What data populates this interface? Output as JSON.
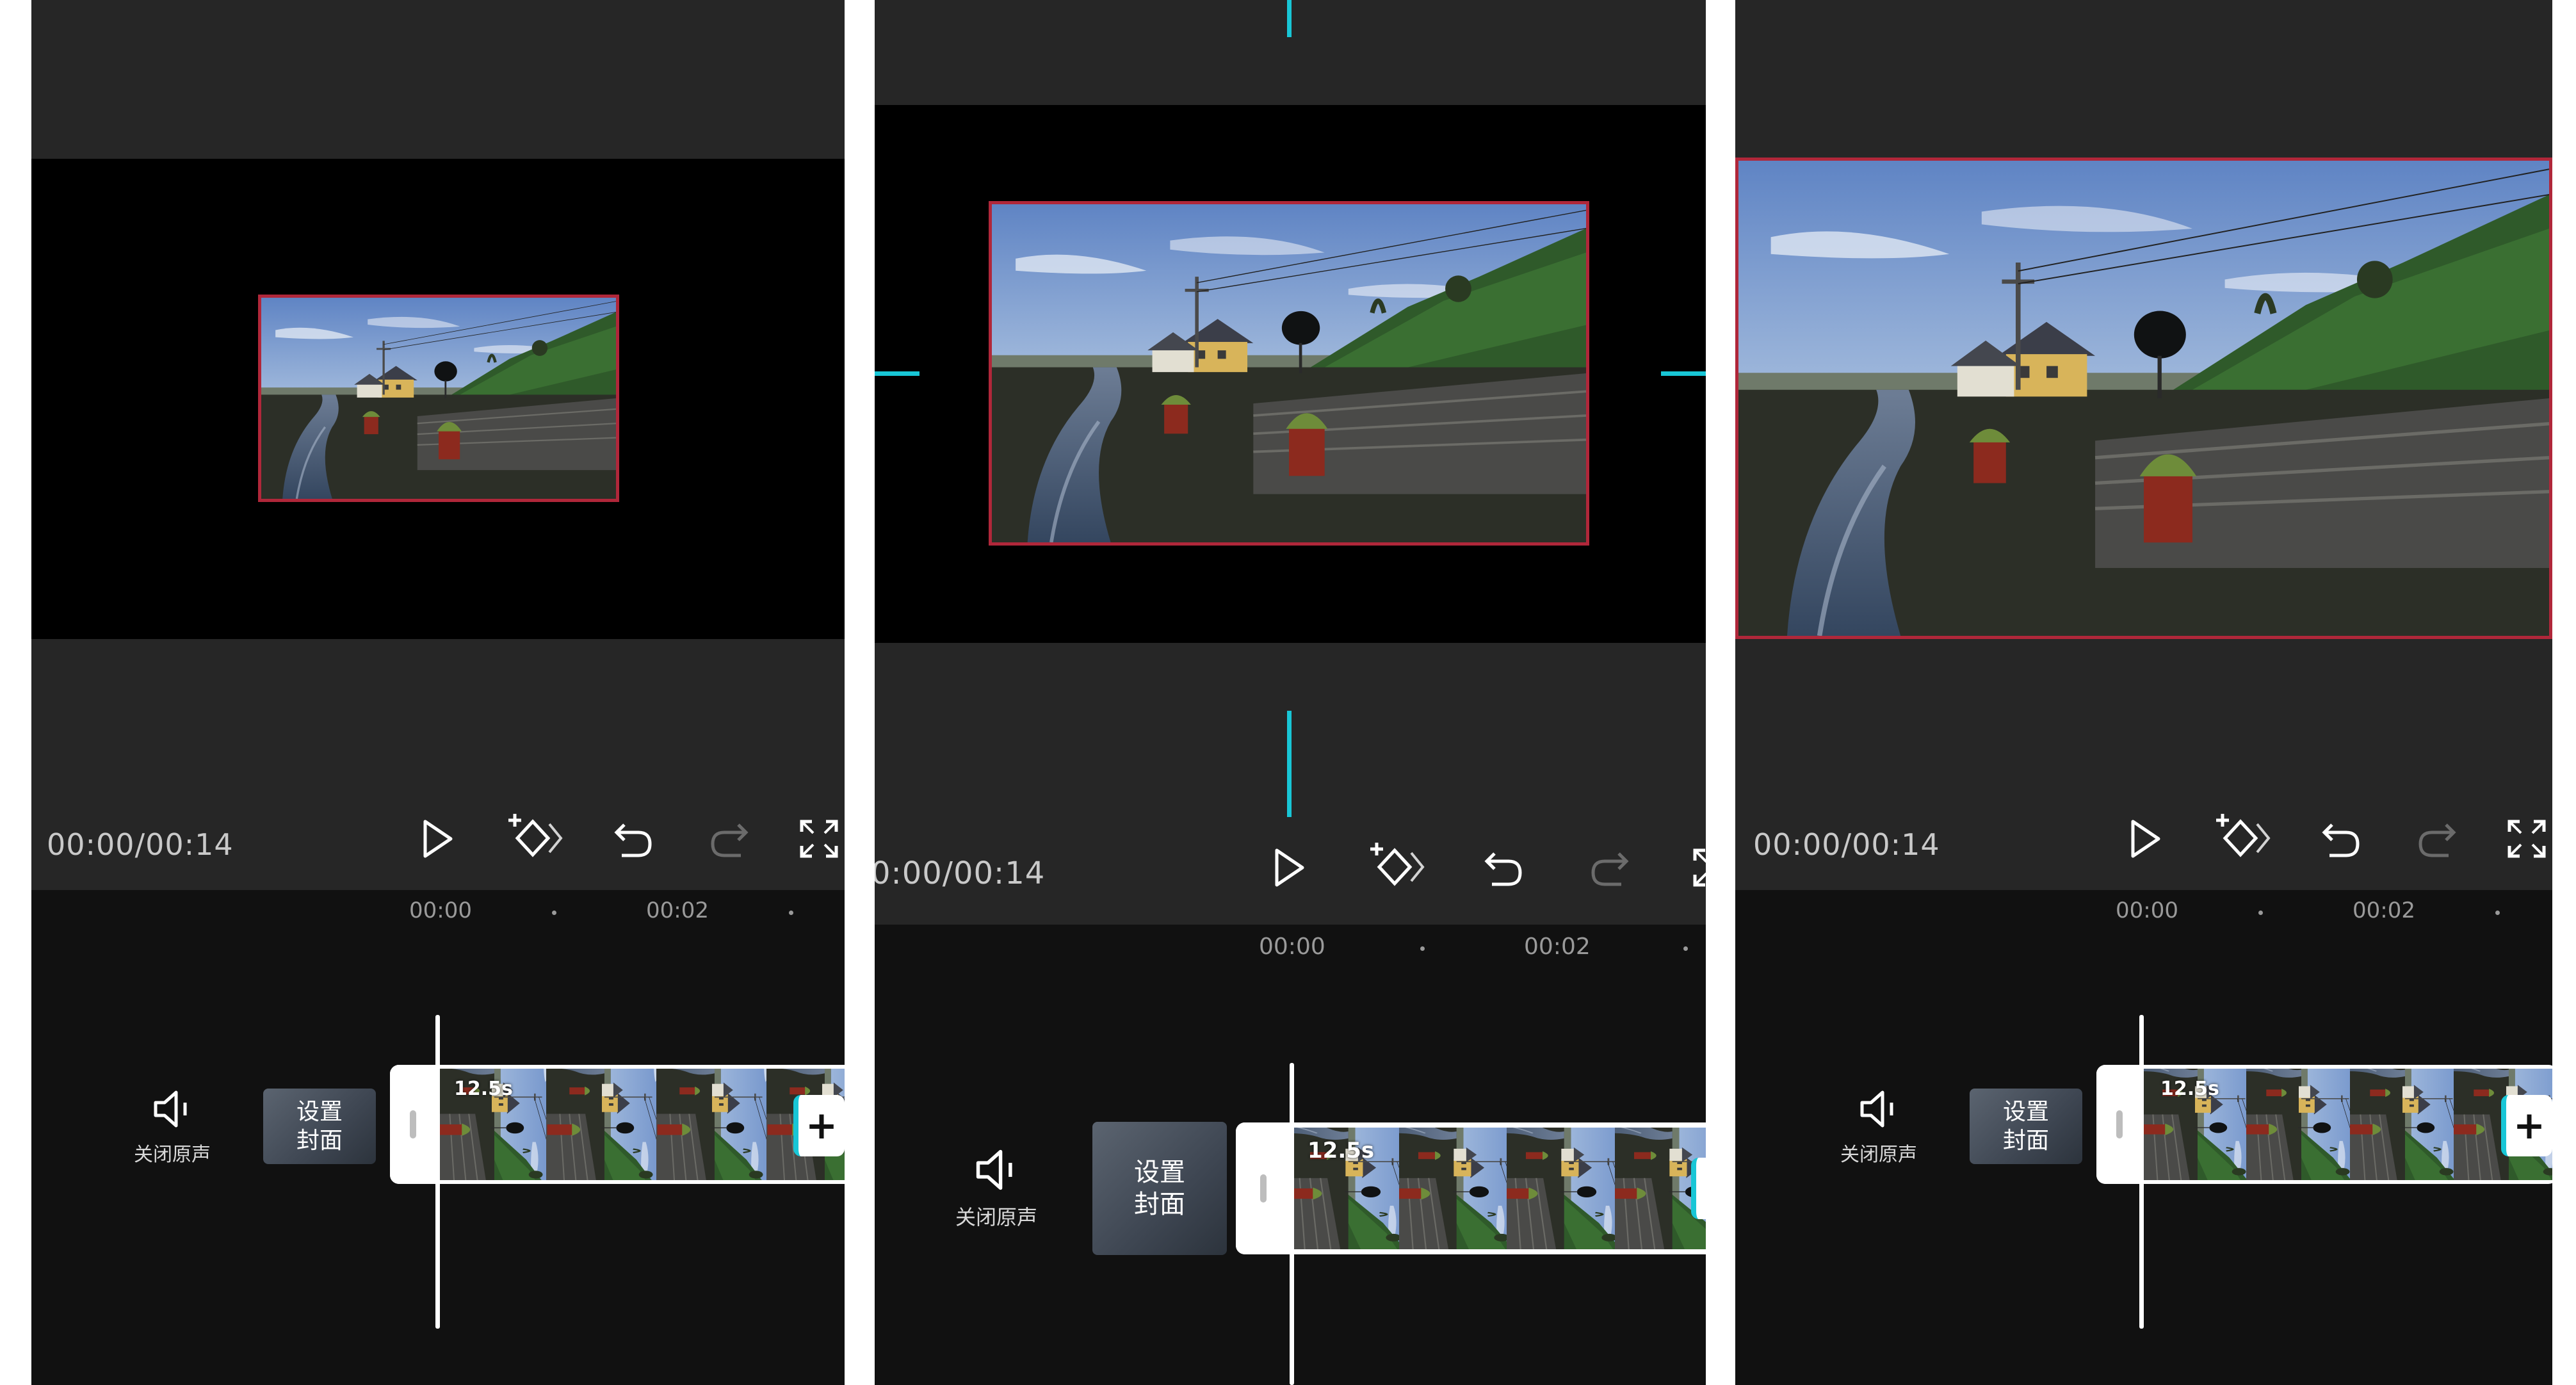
{
  "time_display": "00:00/00:14",
  "time_display_cropped": "0:00/00:14",
  "ruler": {
    "tick_0": "00:00",
    "tick_1": "00:02"
  },
  "mute": {
    "label": "关闭原声"
  },
  "cover": {
    "line1": "设置",
    "line2": "封面"
  },
  "clip": {
    "duration": "12.5s"
  },
  "add_clip": {
    "label": "+"
  },
  "colors": {
    "selection_border": "#b0273a",
    "guide_accent": "#18c6d6",
    "panel_bg": "#262626",
    "timeline_bg": "#121212"
  },
  "icons": [
    "speaker-mute-icon",
    "play-icon",
    "keyframe-add-icon",
    "undo-icon",
    "redo-icon",
    "fullscreen-icon",
    "plus-icon"
  ]
}
